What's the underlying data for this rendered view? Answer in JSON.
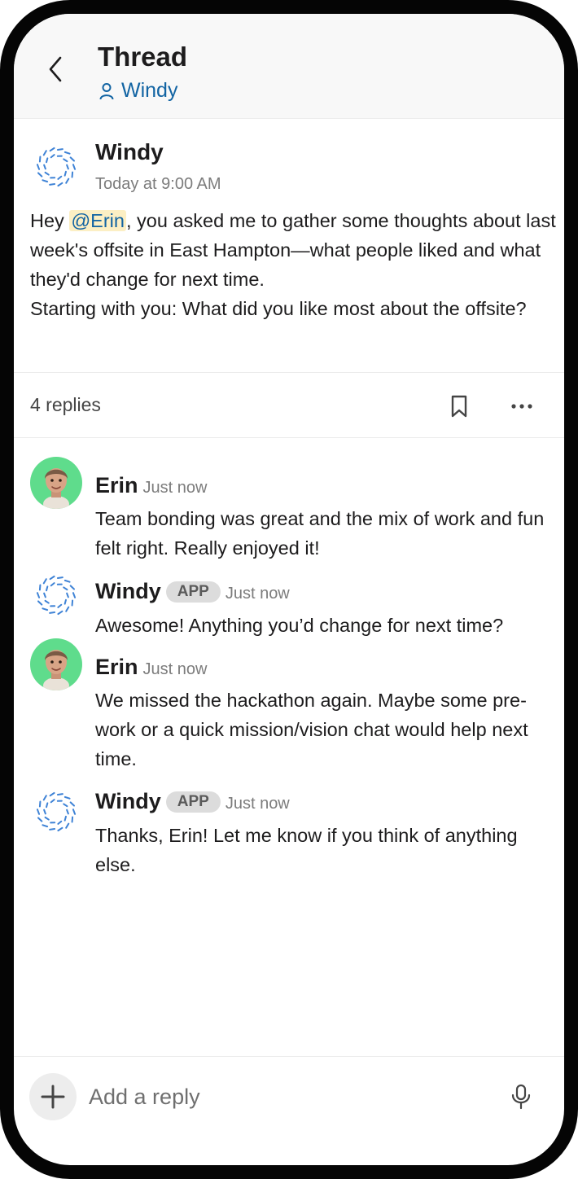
{
  "header": {
    "title": "Thread",
    "subtitle": "Windy"
  },
  "parent_message": {
    "author": "Windy",
    "time": "Today at 9:00 AM",
    "text_before_mention": "Hey ",
    "mention": "@Erin",
    "text_after_mention": ", you asked me to gather some thoughts about last week's offsite in East Hampton—what people liked and what they'd change for next time.",
    "text_line2": "Starting with you: What did you like most about the offsite?"
  },
  "thread_bar": {
    "replies": "4 replies",
    "icons": [
      "bookmark-icon",
      "more-icon"
    ]
  },
  "replies": [
    {
      "author": "Erin",
      "badge": "",
      "time": "Just now",
      "text": "Team bonding was great and the mix of work and fun felt right. Really enjoyed it!"
    },
    {
      "author": "Windy",
      "badge": "APP",
      "time": "Just now",
      "text": "Awesome! Anything you’d change for next time?"
    },
    {
      "author": "Erin",
      "badge": "",
      "time": "Just now",
      "text": "We missed the hackathon again. Maybe some pre-work or a quick mission/vision chat would help next time."
    },
    {
      "author": "Windy",
      "badge": "APP",
      "time": "Just now",
      "text": "Thanks, Erin! Let me know if you think of anything else."
    }
  ],
  "composer": {
    "placeholder": "Add a reply"
  },
  "colors": {
    "link": "#1264a3",
    "mention_bg": "#fcefc4",
    "erin_avatar_bg": "#5fdc8c",
    "windy_dots": "#3f83d6"
  }
}
